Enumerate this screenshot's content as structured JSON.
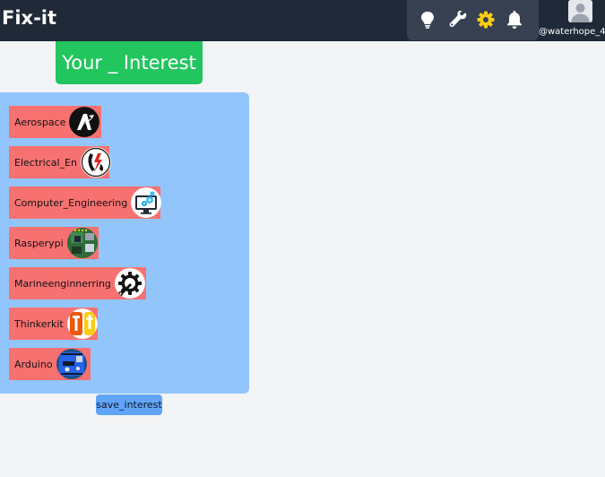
{
  "header": {
    "brand": "Fix-it",
    "icons": [
      "lightbulb-icon",
      "wrench-icon",
      "gear-icon",
      "bell-icon"
    ],
    "profile": {
      "username": "@waterhope_4"
    }
  },
  "main": {
    "title": "Your _ Interest",
    "interests": [
      {
        "label": "Aerospace",
        "icon": "aerospace-logo"
      },
      {
        "label": "Electrical_En",
        "icon": "electrical-logo"
      },
      {
        "label": "Computer_Engineering",
        "icon": "computer-monitor-gears"
      },
      {
        "label": "Rasperypi",
        "icon": "raspberry-pi-board"
      },
      {
        "label": "Marineenginnerring",
        "icon": "gear-wrench"
      },
      {
        "label": "Thinkerkit",
        "icon": "thinkerkit-logo"
      },
      {
        "label": "Arduino",
        "icon": "arduino-board"
      }
    ],
    "save_label": "save_interest"
  },
  "colors": {
    "topbar": "#1f2937",
    "icon_group": "#374151",
    "title_bg": "#22c55e",
    "panel_bg": "#93c5fd",
    "item_bg": "#f87171",
    "save_bg": "#60a5fa",
    "gear_accent": "#facc15"
  }
}
